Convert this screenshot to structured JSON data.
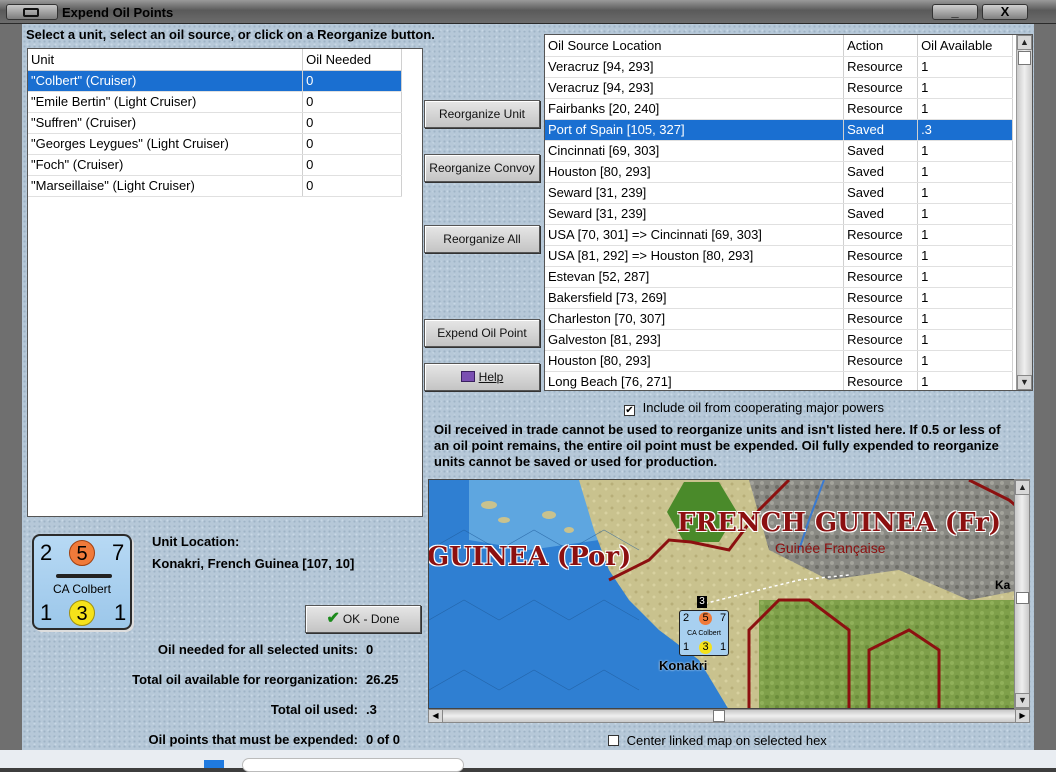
{
  "window": {
    "title": "Expend Oil Points",
    "minimize_label": "_",
    "close_label": "X"
  },
  "instructions": "Select a unit, select an oil source, or click on a Reorganize button.",
  "units_table": {
    "headers": [
      "Unit",
      "Oil Needed"
    ],
    "rows": [
      {
        "unit": "\"Colbert\" (Cruiser)",
        "oil": "0",
        "selected": true
      },
      {
        "unit": "\"Emile Bertin\" (Light Cruiser)",
        "oil": "0"
      },
      {
        "unit": "\"Suffren\" (Cruiser)",
        "oil": "0"
      },
      {
        "unit": "\"Georges Leygues\" (Light Cruiser)",
        "oil": "0"
      },
      {
        "unit": "\"Foch\" (Cruiser)",
        "oil": "0"
      },
      {
        "unit": "\"Marseillaise\" (Light Cruiser)",
        "oil": "0"
      }
    ]
  },
  "buttons": {
    "reorganize_unit": "Reorganize Unit",
    "reorganize_convoy": "Reorganize Convoy",
    "reorganize_all": "Reorganize All",
    "expend_oil_point": "Expend Oil Point",
    "help": "Help",
    "ok_done": "OK - Done"
  },
  "sources_table": {
    "headers": [
      "Oil Source Location",
      "Action",
      "Oil Available"
    ],
    "rows": [
      {
        "loc": "Veracruz [94, 293]",
        "action": "Resource",
        "oil": "1"
      },
      {
        "loc": "Veracruz [94, 293]",
        "action": "Resource",
        "oil": "1"
      },
      {
        "loc": "Fairbanks [20, 240]",
        "action": "Resource",
        "oil": "1"
      },
      {
        "loc": "Port of Spain [105, 327]",
        "action": "Saved",
        "oil": ".3",
        "selected": true
      },
      {
        "loc": "Cincinnati [69, 303]",
        "action": "Saved",
        "oil": "1"
      },
      {
        "loc": "Houston [80, 293]",
        "action": "Saved",
        "oil": "1"
      },
      {
        "loc": "Seward [31, 239]",
        "action": "Saved",
        "oil": "1"
      },
      {
        "loc": "Seward [31, 239]",
        "action": "Saved",
        "oil": "1"
      },
      {
        "loc": "USA [70, 301] => Cincinnati [69, 303]",
        "action": "Resource",
        "oil": "1"
      },
      {
        "loc": "USA [81, 292] => Houston [80, 293]",
        "action": "Resource",
        "oil": "1"
      },
      {
        "loc": "Estevan [52, 287]",
        "action": "Resource",
        "oil": "1"
      },
      {
        "loc": "Bakersfield [73, 269]",
        "action": "Resource",
        "oil": "1"
      },
      {
        "loc": "Charleston [70, 307]",
        "action": "Resource",
        "oil": "1"
      },
      {
        "loc": "Galveston [81, 293]",
        "action": "Resource",
        "oil": "1"
      },
      {
        "loc": "Houston [80, 293]",
        "action": "Resource",
        "oil": "1"
      },
      {
        "loc": "Long Beach [76, 271]",
        "action": "Resource",
        "oil": "1"
      }
    ]
  },
  "include_cooperating": {
    "label": "Include oil from cooperating major powers",
    "checked": true
  },
  "notice": "Oil received in trade cannot be used to reorganize units and isn't listed here.  If 0.5 or less of an oil point remains, the entire oil point must be expended.   Oil fully expended to reorganize units cannot be saved or used for production.",
  "counter": {
    "attack": "2",
    "movement": "5",
    "defense": "7",
    "name": "CA Colbert",
    "bottom_left": "1",
    "bottom_mid": "3",
    "bottom_right": "1",
    "colors": {
      "movement_circle": "#f07a3a",
      "mid_circle": "#f5e21a",
      "body": "#a8d0f0"
    }
  },
  "unit_location": {
    "label": "Unit Location:",
    "value": "Konakri, French Guinea [107, 10]"
  },
  "stats": {
    "oil_needed_label": "Oil needed for all selected units:",
    "oil_needed_value": "0",
    "total_available_label": "Total oil available for reorganization:",
    "total_available_value": "26.25",
    "total_used_label": "Total oil used:",
    "total_used_value": ".3",
    "must_expend_label": "Oil points that must be expended:",
    "must_expend_value": "0 of 0"
  },
  "map": {
    "region_main": "FRENCH GUINEA (Fr)",
    "region_sub": "Guinée Française",
    "region_left": "GUINEA (Por)",
    "city": "Konakri",
    "edge_label": "Ka",
    "stack_count": "3",
    "mini_counter": {
      "attack": "2",
      "movement": "5",
      "defense": "7",
      "name": "CA Colbert",
      "bl": "1",
      "bm": "3",
      "br": "1"
    }
  },
  "center_linked": {
    "label": "Center linked map on selected hex",
    "checked": false
  }
}
